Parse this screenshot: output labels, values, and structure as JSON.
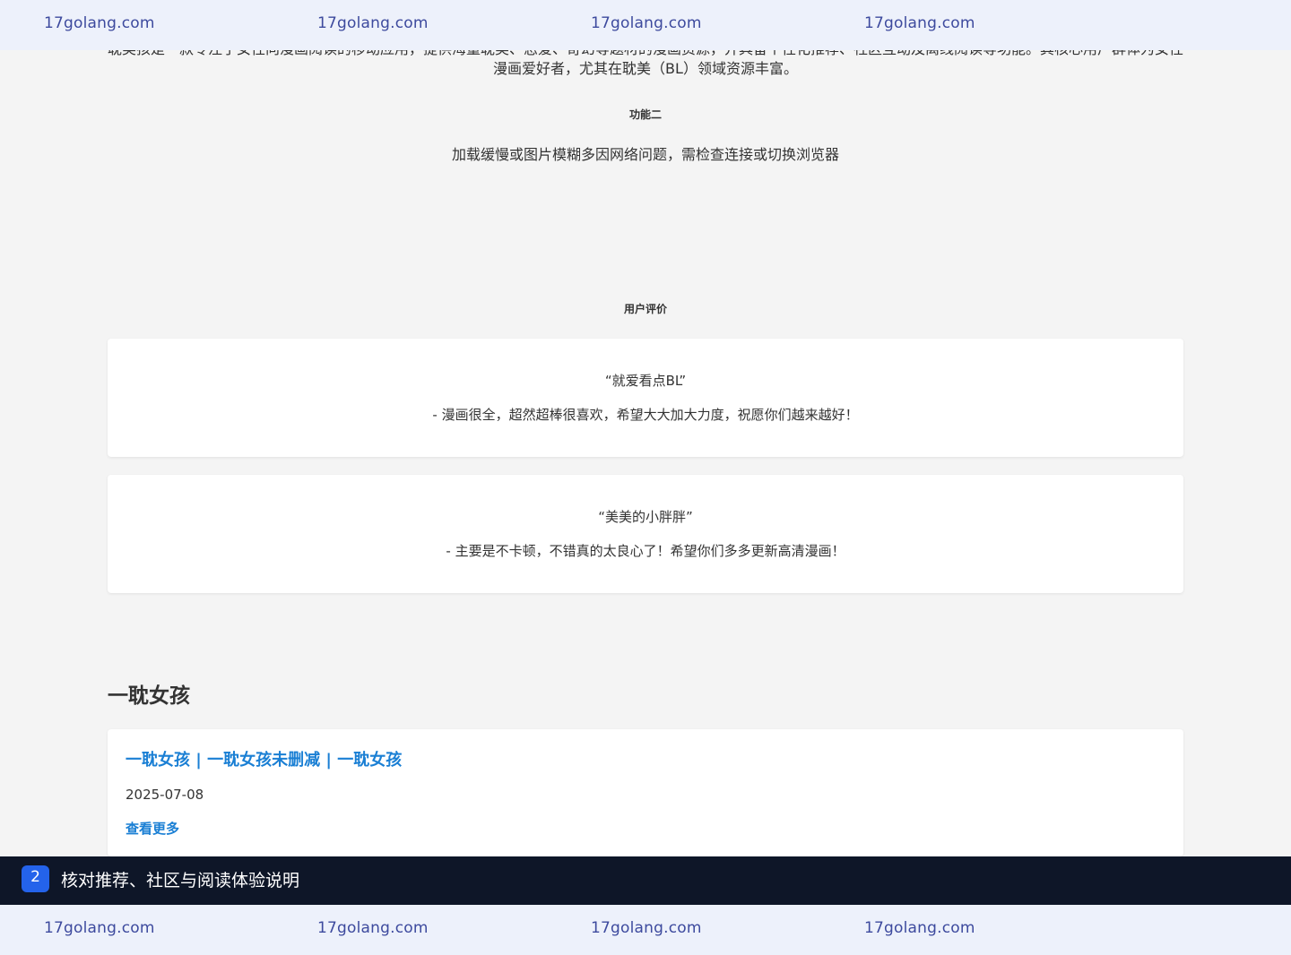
{
  "watermark": {
    "items": [
      "17golang.com",
      "17golang.com",
      "17golang.com",
      "17golang.com"
    ]
  },
  "intro": {
    "text": "耽美孩是一款专注于女性向漫画阅读的移动应用，提供海量耽美、恋爱、奇幻等题材的漫画资源，并具备个性化推荐、社区互动及离线阅读等功能。其核心用户群体为女性漫画爱好者，尤其在耽美（BL）领域资源丰富。"
  },
  "feature": {
    "label": "功能二",
    "description": "加载缓慢或图片模糊多因网络问题，需检查连接或切换浏览器"
  },
  "reviews": {
    "label": "用户评价",
    "items": [
      {
        "title": "“就爱看点BL”",
        "body": "- 漫画很全，超然超棒很喜欢，希望大大加大力度，祝愿你们越来越好！"
      },
      {
        "title": "“美美的小胖胖”",
        "body": "- 主要是不卡顿，不错真的太良心了！希望你们多多更新高清漫画！"
      }
    ]
  },
  "site": {
    "heading": "一耽女孩"
  },
  "article": {
    "title": "一耽女孩 | 一耽女孩未删减 | 一耽女孩",
    "date": "2025-07-08",
    "more": "查看更多"
  },
  "banner": {
    "step": "2",
    "title": "核对推荐、社区与阅读体验说明"
  },
  "colors": {
    "accent": "#1a7fd4",
    "watermark": "#3d4a9e",
    "banner_bg": "#0e1628",
    "badge": "#2463eb"
  }
}
